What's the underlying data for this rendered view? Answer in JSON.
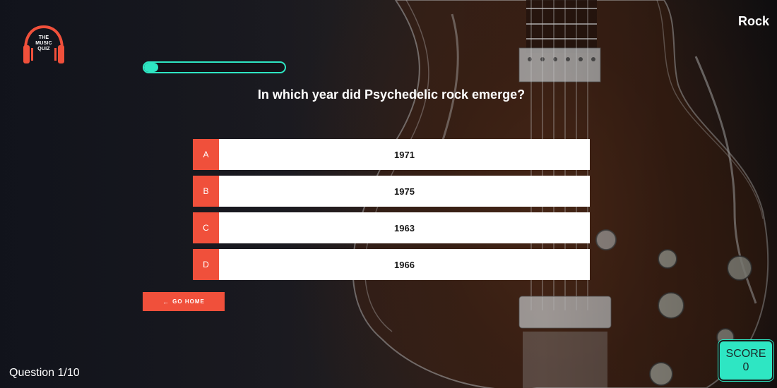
{
  "app": {
    "logo_text": "THE MUSIC QUIZ",
    "genre": "Rock"
  },
  "quiz": {
    "progress_fraction": 0.1,
    "question": "In which year did Psychedelic rock emerge?",
    "answers": [
      {
        "letter": "A",
        "text": "1971"
      },
      {
        "letter": "B",
        "text": "1975"
      },
      {
        "letter": "C",
        "text": "1963"
      },
      {
        "letter": "D",
        "text": "1966"
      }
    ],
    "go_home_label": "GO HOME",
    "go_home_icon": "arrow-left-icon",
    "counter": "Question 1/10"
  },
  "score": {
    "label": "SCORE",
    "value": "0"
  },
  "colors": {
    "accent": "#f0503b",
    "teal": "#2ee6c3"
  }
}
